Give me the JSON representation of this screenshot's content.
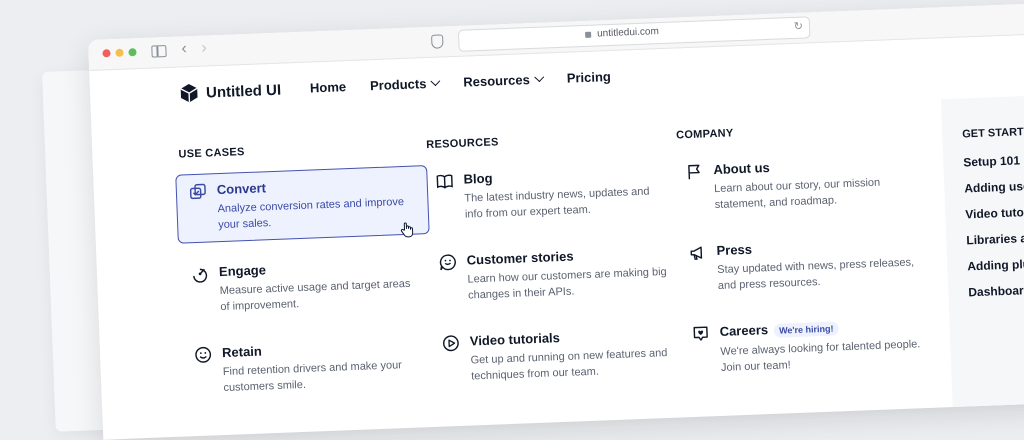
{
  "browser": {
    "url": "untitledui.com"
  },
  "header": {
    "logo": "Untitled UI",
    "nav": [
      {
        "label": "Home",
        "dropdown": false
      },
      {
        "label": "Products",
        "dropdown": true
      },
      {
        "label": "Resources",
        "dropdown": true
      },
      {
        "label": "Pricing",
        "dropdown": false
      }
    ]
  },
  "use_cases": {
    "title": "USE CASES",
    "items": [
      {
        "title": "Convert",
        "desc": "Analyze conversion rates and improve your sales.",
        "icon": "convert-icon"
      },
      {
        "title": "Engage",
        "desc": "Measure active usage and target areas of improvement.",
        "icon": "engage-icon"
      },
      {
        "title": "Retain",
        "desc": "Find retention drivers and make your customers smile.",
        "icon": "smile-icon"
      }
    ]
  },
  "resources": {
    "title": "RESOURCES",
    "items": [
      {
        "title": "Blog",
        "desc": "The latest industry news, updates and info from our expert team.",
        "icon": "book-icon"
      },
      {
        "title": "Customer stories",
        "desc": "Learn how our customers are making big changes in their APIs.",
        "icon": "chat-smile-icon"
      },
      {
        "title": "Video tutorials",
        "desc": "Get up and running on new features and techniques from our team.",
        "icon": "play-icon"
      }
    ]
  },
  "company": {
    "title": "COMPANY",
    "items": [
      {
        "title": "About us",
        "desc": "Learn about our story, our mission statement, and roadmap.",
        "icon": "flag-icon"
      },
      {
        "title": "Press",
        "desc": "Stay updated with news, press releases, and press resources.",
        "icon": "megaphone-icon"
      },
      {
        "title": "Careers",
        "badge": "We're hiring!",
        "desc": "We're always looking for talented people. Join our team!",
        "icon": "heart-square-icon"
      }
    ]
  },
  "get_started": {
    "title": "GET STARTE",
    "items": [
      "Setup 101",
      "Adding use",
      "Video tutor",
      "Libraries a",
      "Adding plu",
      "Dashboar"
    ]
  }
}
